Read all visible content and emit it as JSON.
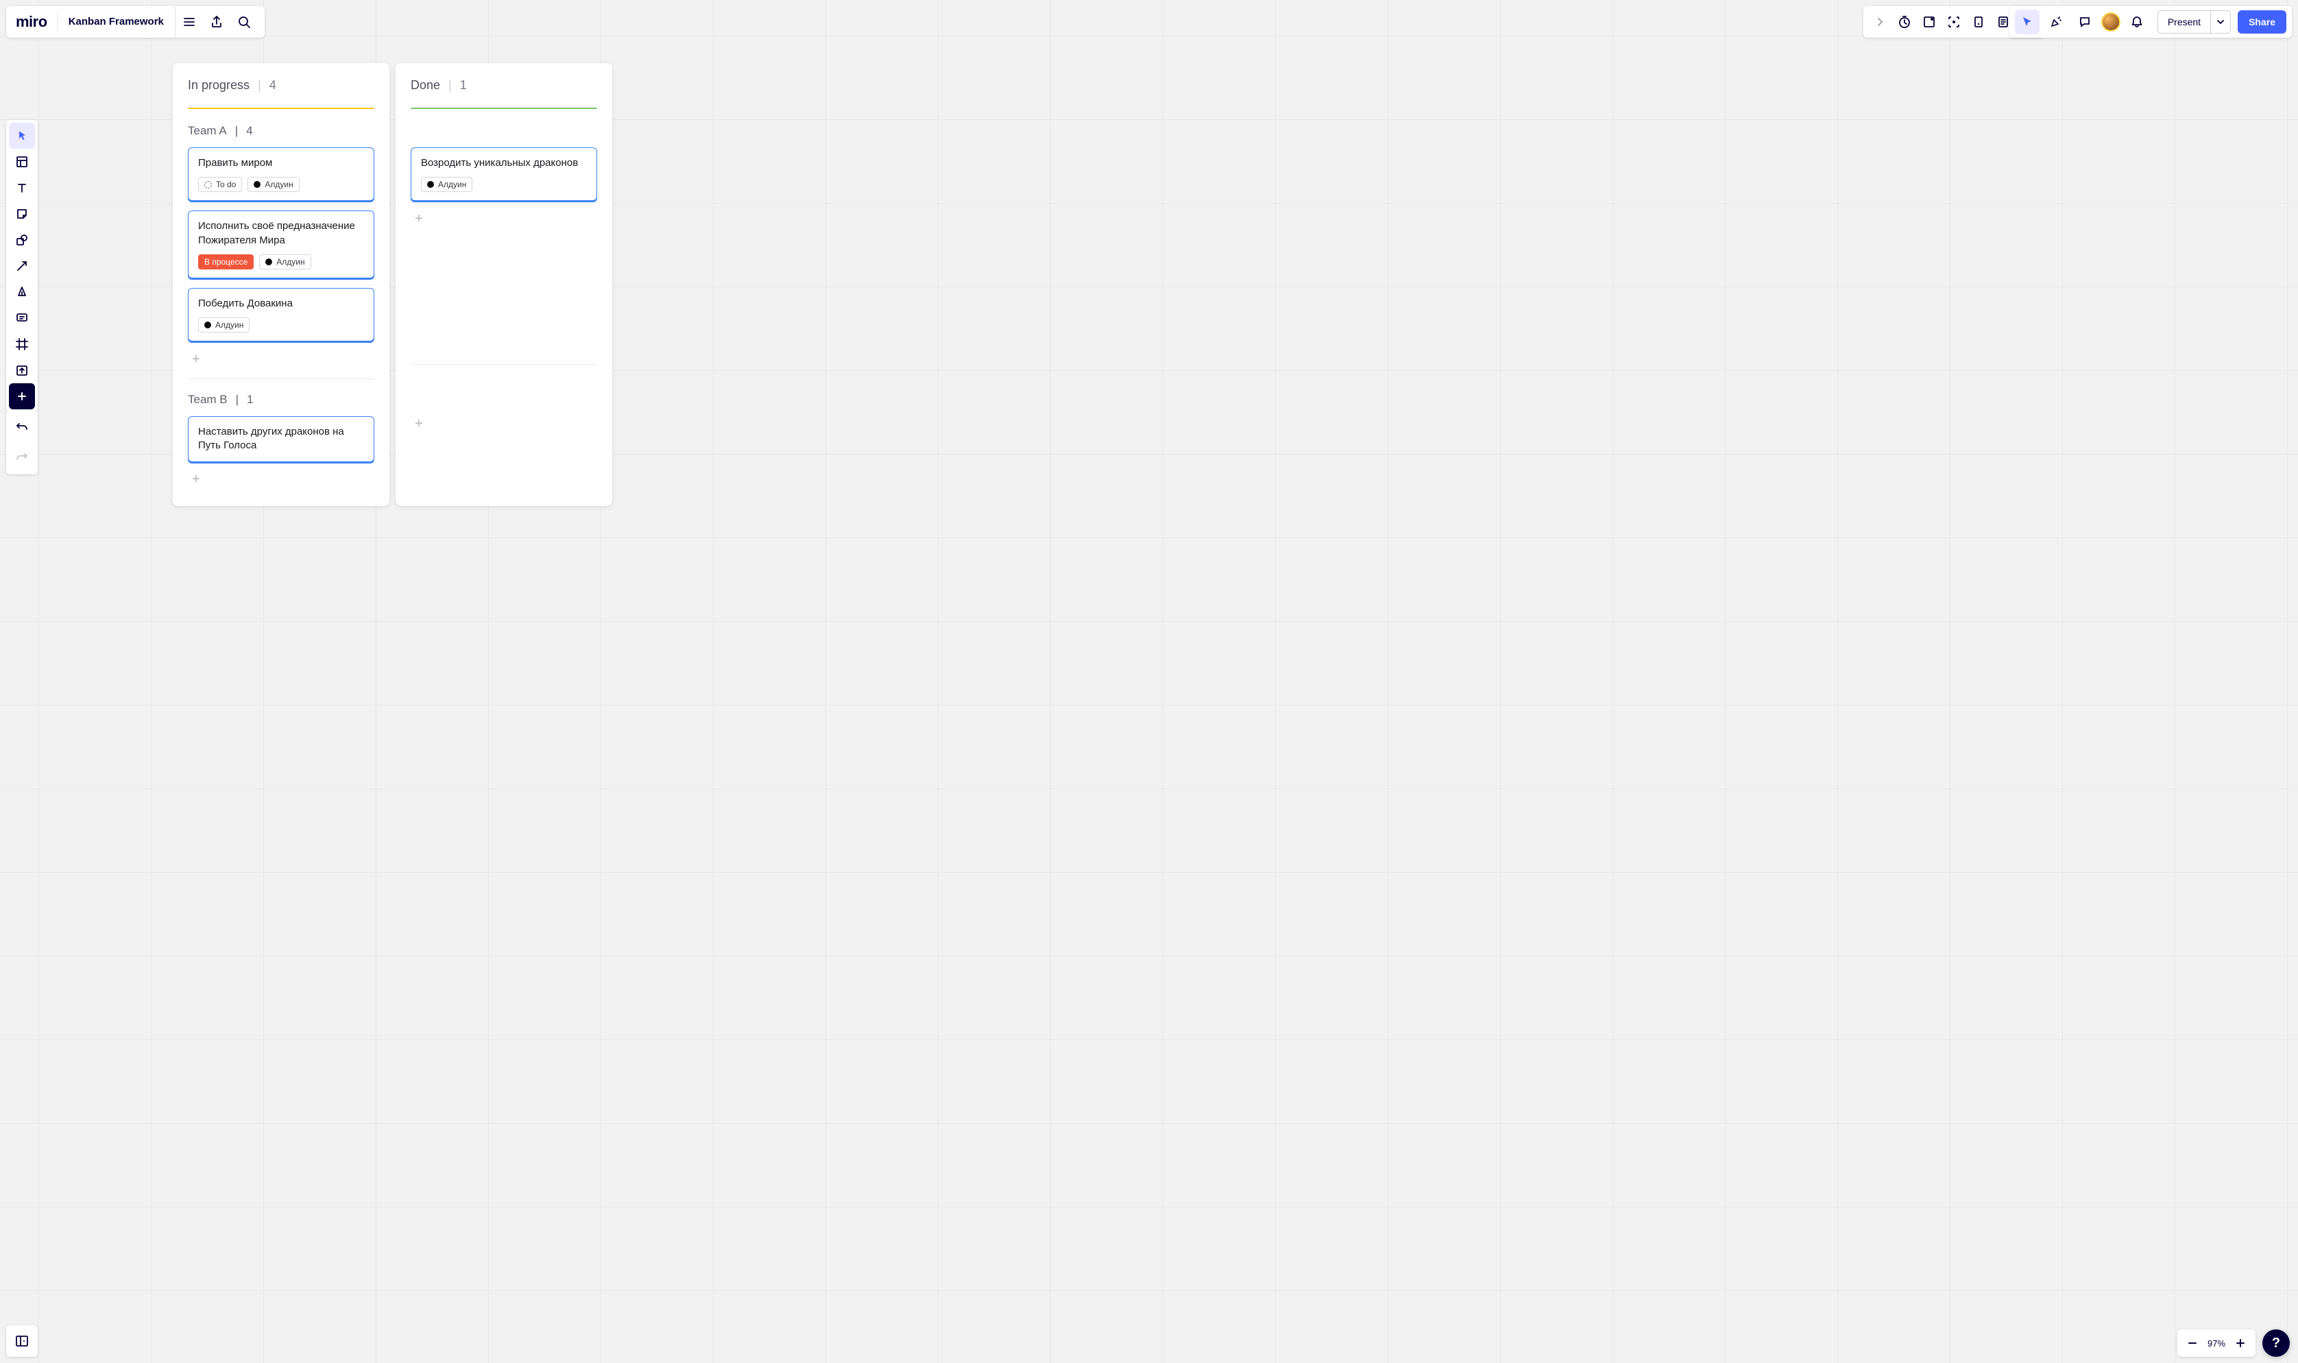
{
  "app": {
    "logo_text": "miro",
    "board_title": "Kanban Framework"
  },
  "topbar_right": {
    "present_label": "Present",
    "share_label": "Share"
  },
  "zoom": {
    "percent": "97%"
  },
  "help": {
    "label": "?"
  },
  "board": {
    "columns": [
      {
        "name": "In progress",
        "count": "4",
        "rule_color": "y",
        "teams": [
          {
            "name": "Team A",
            "count": "4",
            "cards": [
              {
                "title": "Править миром",
                "tags": [
                  {
                    "kind": "status-todo",
                    "label": "To do"
                  },
                  {
                    "kind": "user",
                    "label": "Алдуин"
                  }
                ]
              },
              {
                "title": "Исполнить своё предназначение Пожирателя Мира",
                "tags": [
                  {
                    "kind": "status-inprog",
                    "label": "В процессе"
                  },
                  {
                    "kind": "user",
                    "label": "Алдуин"
                  }
                ]
              },
              {
                "title": "Победить Довакина",
                "tags": [
                  {
                    "kind": "user",
                    "label": "Алдуин"
                  }
                ]
              }
            ]
          },
          {
            "name": "Team B",
            "count": "1",
            "cards": [
              {
                "title": "Наставить других драконов на Путь Голоса",
                "tags": []
              }
            ]
          }
        ]
      },
      {
        "name": "Done",
        "count": "1",
        "rule_color": "g",
        "teams": [
          {
            "name": "",
            "count": "",
            "cards": [
              {
                "title": "Возродить уникальных драконов",
                "tags": [
                  {
                    "kind": "user",
                    "label": "Алдуин"
                  }
                ]
              }
            ]
          },
          {
            "name": "",
            "count": "",
            "cards": []
          }
        ]
      }
    ]
  }
}
